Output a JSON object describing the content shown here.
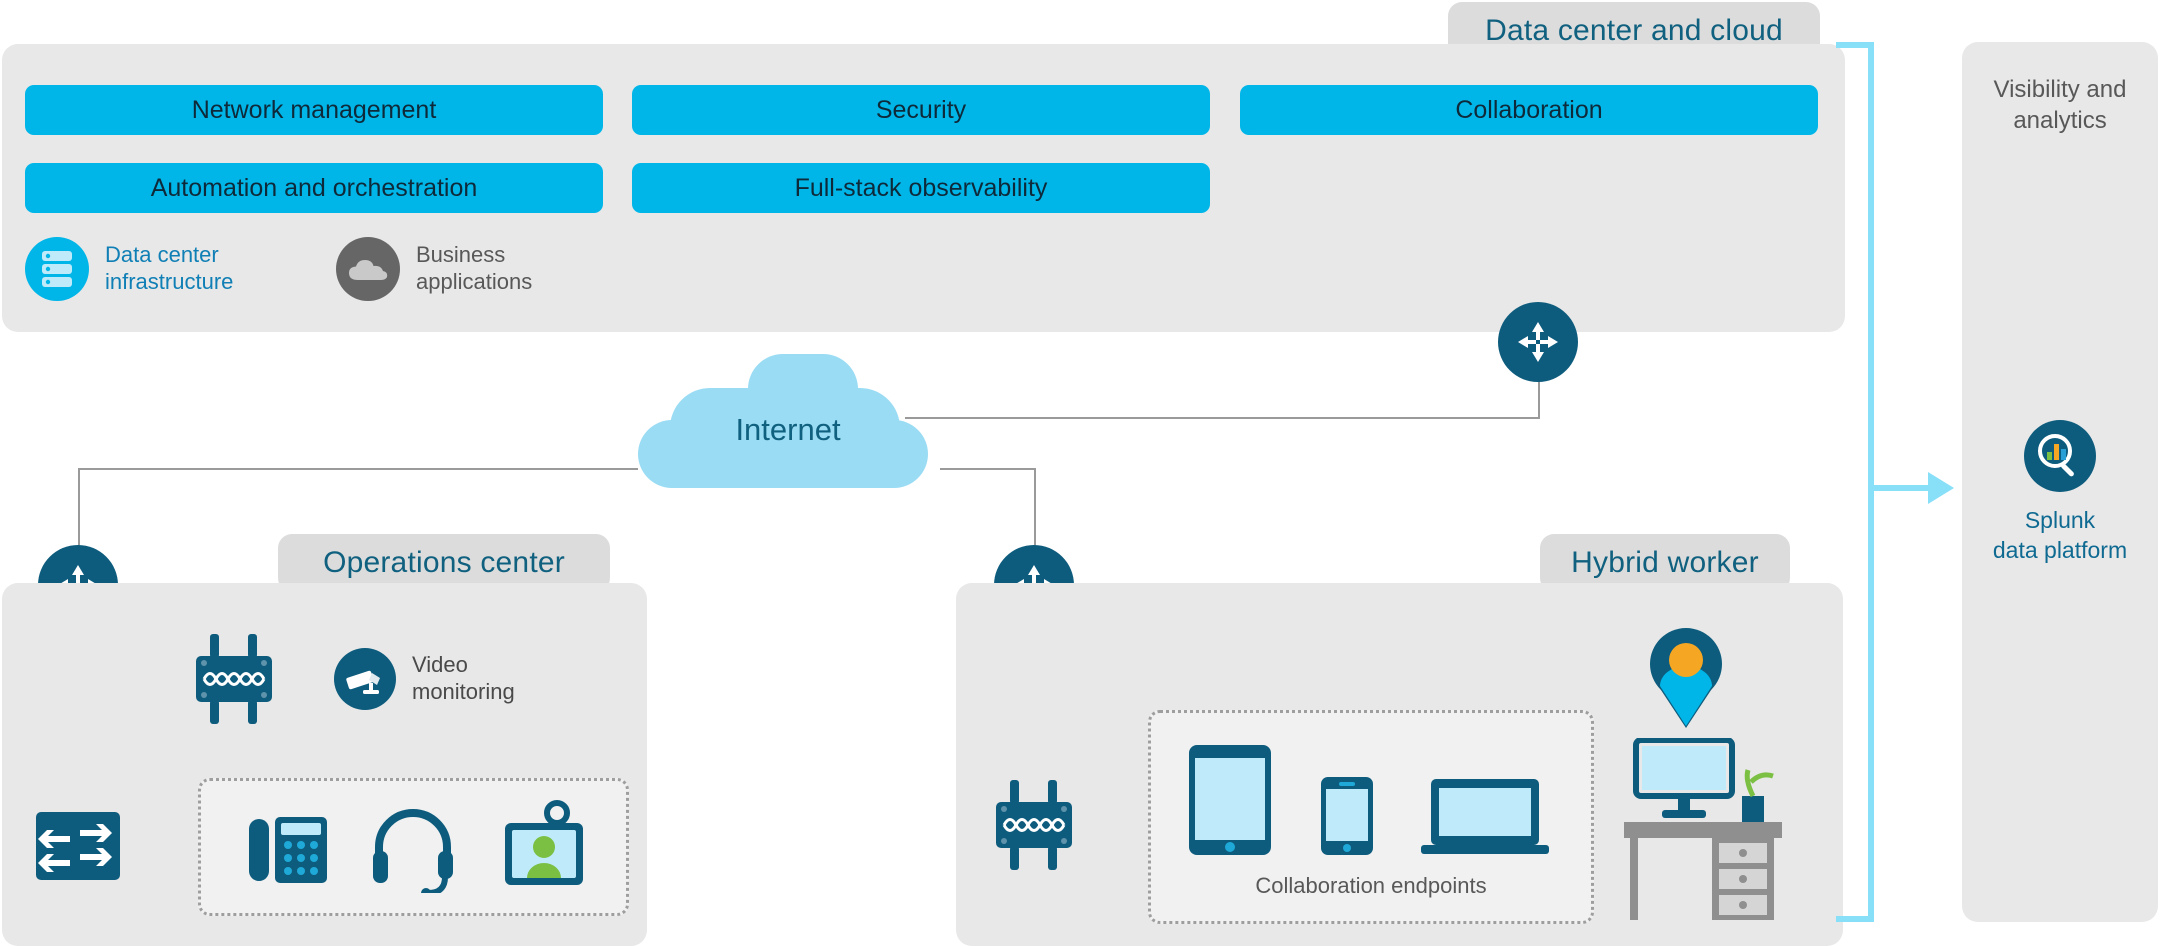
{
  "colors": {
    "pill_blue": "#00b6e8",
    "deep_teal": "#0d5c7d",
    "light_blue": "#9adcf4",
    "panel_gray": "#e8e8e8",
    "tab_gray": "#dcdcdc",
    "bracket_blue": "#87dff8",
    "accent_orange": "#f5a623",
    "accent_green": "#7bc043",
    "line_gray": "#9a9a9a"
  },
  "datacenter": {
    "tab_label": "Data center and cloud",
    "pills": [
      {
        "label": "Network management"
      },
      {
        "label": "Security"
      },
      {
        "label": "Collaboration"
      },
      {
        "label": "Automation and orchestration"
      },
      {
        "label": "Full-stack observability"
      }
    ],
    "assets": [
      {
        "label": "Data center infrastructure",
        "line1": "Data center",
        "line2": "infrastructure",
        "icon": "server-stack-icon",
        "style": "blue"
      },
      {
        "label": "Business applications",
        "line1": "Business",
        "line2": "applications",
        "icon": "cloud-icon",
        "style": "gray"
      }
    ]
  },
  "internet": {
    "label": "Internet",
    "icon": "cloud-icon"
  },
  "operations_center": {
    "tab_label": "Operations center",
    "video": {
      "line1": "Video",
      "line2": "monitoring",
      "icon": "video-camera-icon"
    },
    "devices": [
      {
        "name": "ip-phone-icon"
      },
      {
        "name": "headset-icon"
      },
      {
        "name": "video-endpoint-icon"
      }
    ],
    "network_devices": [
      {
        "name": "wireless-access-point-icon"
      },
      {
        "name": "network-switch-icon"
      }
    ]
  },
  "hybrid_worker": {
    "tab_label": "Hybrid worker",
    "endpoints_label": "Collaboration endpoints",
    "endpoints": [
      {
        "name": "tablet-icon"
      },
      {
        "name": "smartphone-icon"
      },
      {
        "name": "laptop-icon"
      }
    ],
    "workstation": {
      "icon": "desk-workstation-icon",
      "pin": "location-pin-icon"
    },
    "network_devices": [
      {
        "name": "wireless-access-point-icon"
      }
    ]
  },
  "analytics": {
    "tab_label": "Visibility and analytics",
    "tab_line1": "Visibility and",
    "tab_line2": "analytics",
    "product": {
      "line1": "Splunk",
      "line2": "data platform",
      "label": "Splunk data platform",
      "icon": "magnifier-chart-icon"
    }
  },
  "routers": [
    {
      "name": "router-icon-datacenter"
    },
    {
      "name": "router-icon-operations"
    },
    {
      "name": "router-icon-hybrid"
    }
  ]
}
